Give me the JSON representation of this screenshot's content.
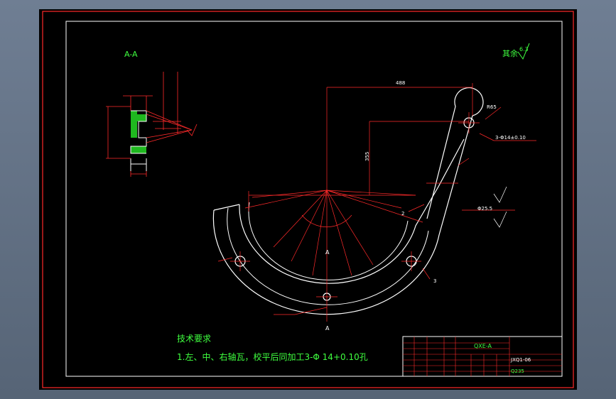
{
  "section": {
    "title": "A-A"
  },
  "roughness_note": {
    "label": "其余",
    "value": "6.3"
  },
  "dims": {
    "d488": "488",
    "d355": "355",
    "r65": "R65",
    "phi": "Φ25.5",
    "phi_hole": "3-Φ14±0.10",
    "d2": "2",
    "d3": "3"
  },
  "tech_req": {
    "title": "技术要求",
    "line1": "1.左、中、右轴瓦，校平后同加工3-Φ 14+0.10孔"
  },
  "section_marks": {
    "top": "A",
    "bottom": "A"
  },
  "title_block": {
    "part_code": "QXE-A",
    "drawing_no": "JXQ1-06",
    "material": "Q235"
  },
  "colors": {
    "frame": "#ff2a2a",
    "drawing": "#ffffff",
    "dimension": "#ff2a2a",
    "text": "#3fff3f",
    "hatch": "#1fb81f"
  }
}
